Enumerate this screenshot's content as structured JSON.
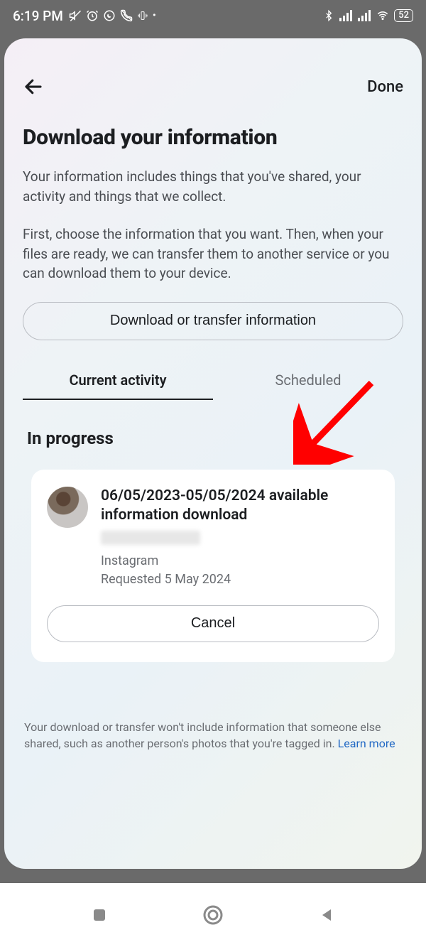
{
  "statusbar": {
    "time": "6:19 PM",
    "battery": "52"
  },
  "header": {
    "done_label": "Done"
  },
  "title": "Download your information",
  "description1": "Your information includes things that you've shared, your activity and things that we collect.",
  "description2": "First, choose the information that you want. Then, when your files are ready, we can transfer them to another service or you can download them to your device.",
  "primary_button_label": "Download or transfer information",
  "tabs": {
    "current": "Current activity",
    "scheduled": "Scheduled"
  },
  "section_header": "In progress",
  "card": {
    "title": "06/05/2023-05/05/2024 available information download",
    "platform": "Instagram",
    "requested": "Requested 5 May 2024",
    "cancel_label": "Cancel"
  },
  "disclaimer": {
    "text": "Your download or transfer won't include information that someone else shared, such as another person's photos that you're tagged in. ",
    "link": "Learn more"
  }
}
